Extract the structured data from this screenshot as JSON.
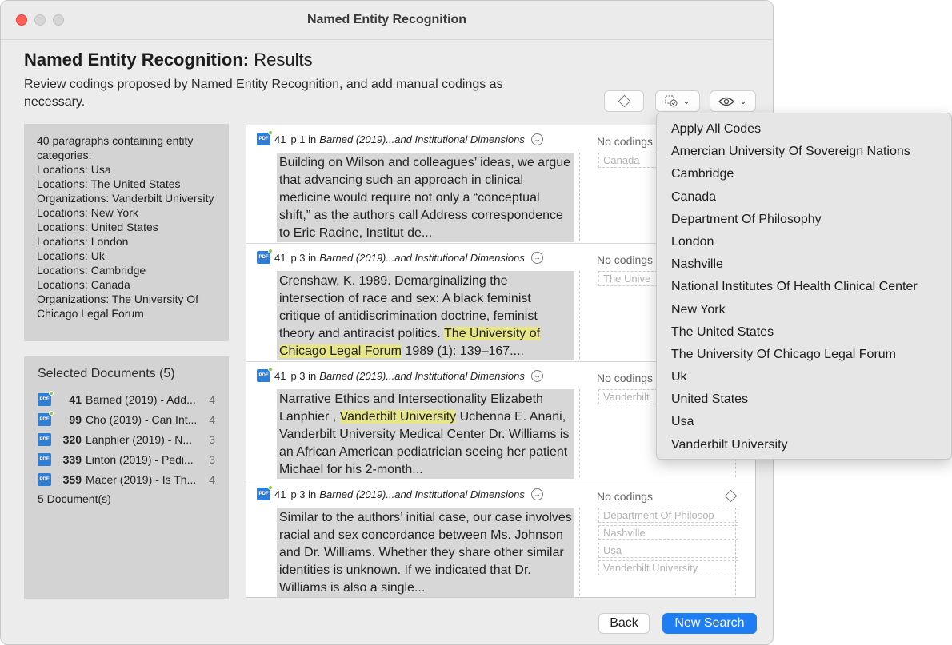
{
  "window": {
    "title": "Named Entity Recognition"
  },
  "header": {
    "title_bold": "Named Entity Recognition:",
    "title_rest": " Results",
    "subtitle": "Review codings proposed by Named Entity Recognition, and add manual codings as necessary."
  },
  "summary": {
    "lines": [
      "40 paragraphs containing entity categories:",
      "Locations: Usa",
      "Locations: The United States",
      "Organizations: Vanderbilt University",
      "Locations: New York",
      "Locations: United States",
      "Locations: London",
      "Locations: Uk",
      "Locations: Cambridge",
      "Locations: Canada",
      "Organizations: The University Of Chicago  Legal Forum"
    ]
  },
  "documents": {
    "title": "Selected Documents (5)",
    "items": [
      {
        "num": "41",
        "name": "Barned (2019) - Add...",
        "count": "4",
        "badge": true
      },
      {
        "num": "99",
        "name": "Cho (2019) - Can Int...",
        "count": "4",
        "badge": true
      },
      {
        "num": "320",
        "name": "Lanphier (2019) - N...",
        "count": "3",
        "badge": false
      },
      {
        "num": "339",
        "name": "Linton (2019) - Pedi...",
        "count": "3",
        "badge": false
      },
      {
        "num": "359",
        "name": "Macer (2019) - Is Th...",
        "count": "4",
        "badge": false
      }
    ],
    "footer": "5 Document(s)"
  },
  "results": [
    {
      "num": "41",
      "pos": "p 1 in",
      "source": "Barned (2019)...and Institutional Dimensions",
      "text_before": "Building on Wilson and colleagues’ ideas, we argue that  advancing such an approach in clinical medicine would  require not only a “conceptual shift,” as the authors call  Address correspondence to Eric Racine, Institut de...",
      "highlight": "",
      "text_after": "",
      "codings": "No codings",
      "tags": [
        "Canada"
      ]
    },
    {
      "num": "41",
      "pos": "p 3 in",
      "source": "Barned (2019)...and Institutional Dimensions",
      "text_before": "Crenshaw, K. 1989. Demarginalizing the intersection of race and  sex: A black feminist critique of antidiscrimination doctrine,  feminist theory and antiracist politics. ",
      "highlight": "The University of Chicago  Legal Forum",
      "text_after": " 1989 (1): 139–167....",
      "codings": "No codings",
      "tags": [
        "The Unive"
      ]
    },
    {
      "num": "41",
      "pos": "p 3 in",
      "source": "Barned (2019)...and Institutional Dimensions",
      "text_before": "Narrative Ethics and Intersectionality  Elizabeth Lanphier , ",
      "highlight": "Vanderbilt University",
      "text_after": "  Uchenna E. Anani, Vanderbilt University Medical Center  Dr. Williams is an African American pediatrician seeing  her patient Michael for his 2-month...",
      "codings": "No codings",
      "tags": [
        "Vanderbilt"
      ]
    },
    {
      "num": "41",
      "pos": "p 3 in",
      "source": "Barned (2019)...and Institutional Dimensions",
      "text_before": "Similar to the authors’ initial case, our case involves  racial and sex concordance between Ms. Johnson and  Dr. Williams. Whether they share other similar identities  is unknown. If we indicated that Dr. Williams is also a  single...",
      "highlight": "",
      "text_after": "",
      "codings": "No codings",
      "tags": [
        "Department Of Philosop",
        "Nashville",
        "Usa",
        "Vanderbilt University"
      ]
    }
  ],
  "footer": {
    "back_label": "Back",
    "new_search_label": "New Search"
  },
  "dropdown": {
    "items": [
      "Apply All Codes",
      "Amercian University Of Sovereign Nations",
      "Cambridge",
      "Canada",
      "Department Of Philosophy",
      "London",
      "Nashville",
      "National Institutes Of Health Clinical Center",
      "New York",
      "The United States",
      "The University Of Chicago  Legal Forum",
      "Uk",
      "United States",
      "Usa",
      "Vanderbilt University"
    ]
  },
  "icons": {
    "pdf": "pdf-document-icon",
    "code": "diamond-code-icon",
    "apply": "apply-codes-icon",
    "view": "eye-icon",
    "goto": "go-to-arrow-icon"
  },
  "colors": {
    "accent": "#1f7df4",
    "highlight": "#e6e689",
    "close": "#ff5f57"
  }
}
